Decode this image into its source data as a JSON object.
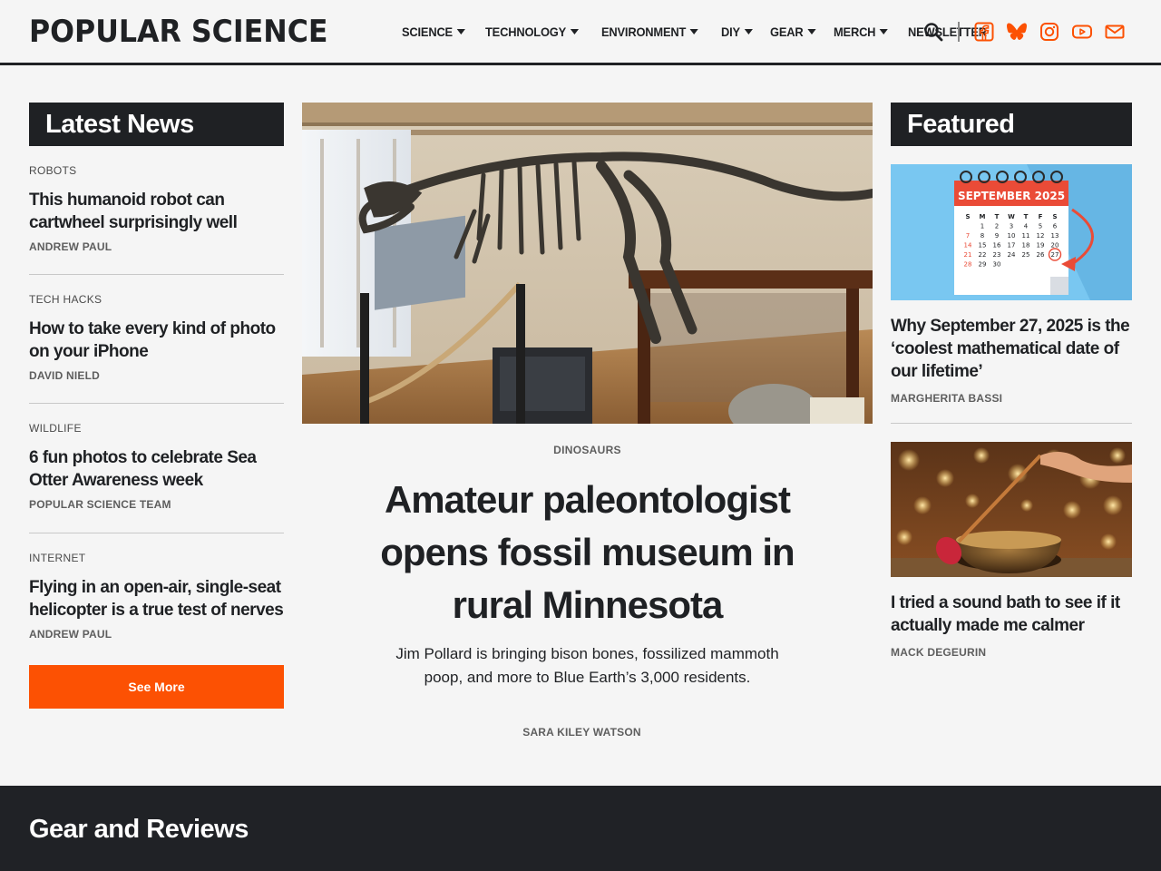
{
  "brand": {
    "logo": "POPULAR SCIENCE",
    "accent": "#fc5103",
    "dark": "#1f2124"
  },
  "nav": {
    "items": [
      {
        "label": "SCIENCE",
        "has_dropdown": true
      },
      {
        "label": "TECHNOLOGY",
        "has_dropdown": true
      },
      {
        "label": "ENVIRONMENT",
        "has_dropdown": true
      },
      {
        "label": "DIY",
        "has_dropdown": true
      },
      {
        "label": "GEAR",
        "has_dropdown": true
      },
      {
        "label": "MERCH",
        "has_dropdown": true
      },
      {
        "label": "NEWSLETTER",
        "has_dropdown": false
      }
    ],
    "icons": [
      "search-icon",
      "facebook-icon",
      "bluesky-icon",
      "instagram-icon",
      "youtube-icon",
      "mail-icon"
    ]
  },
  "latest": {
    "heading": "Latest News",
    "items": [
      {
        "category": "ROBOTS",
        "title": "This humanoid robot can cartwheel surprisingly well",
        "author": "ANDREW PAUL"
      },
      {
        "category": "TECH HACKS",
        "title": "How to take every kind of photo on your iPhone",
        "author": "DAVID NIELD"
      },
      {
        "category": "WILDLIFE",
        "title": "6 fun photos to celebrate Sea Otter Awareness week",
        "author": "POPULAR SCIENCE TEAM"
      },
      {
        "category": "INTERNET",
        "title": "Flying in an open-air, single-seat helicopter is a true test of nerves",
        "author": "ANDREW PAUL"
      }
    ],
    "see_more": "See More"
  },
  "main": {
    "category": "DINOSAURS",
    "title": "Amateur paleontologist opens fossil museum in rural Minnesota",
    "dek": "Jim Pollard is bringing bison bones, fossilized mammoth poop, and more to Blue Earth’s 3,000 residents.",
    "author": "SARA KILEY WATSON"
  },
  "featured": {
    "heading": "Featured",
    "items": [
      {
        "title": "Why September 27, 2025 is the ‘coolest mathematical date of our lifetime’",
        "author": "MARGHERITA BASSI",
        "calendar": {
          "month_label": "SEPTEMBER 2025",
          "weekdays": [
            "S",
            "M",
            "T",
            "W",
            "T",
            "F",
            "S"
          ],
          "rows": [
            [
              "",
              "1",
              "2",
              "3",
              "4",
              "5",
              "6"
            ],
            [
              "7",
              "8",
              "9",
              "10",
              "11",
              "12",
              "13"
            ],
            [
              "14",
              "15",
              "16",
              "17",
              "18",
              "19",
              "20"
            ],
            [
              "21",
              "22",
              "23",
              "24",
              "25",
              "26",
              "27"
            ],
            [
              "28",
              "29",
              "30",
              "",
              "",
              "",
              ""
            ]
          ]
        }
      },
      {
        "title": "I tried a sound bath to see if it actually made me calmer",
        "author": "MACK DEGEURIN"
      }
    ]
  },
  "bottom": {
    "heading": "Gear and Reviews"
  }
}
